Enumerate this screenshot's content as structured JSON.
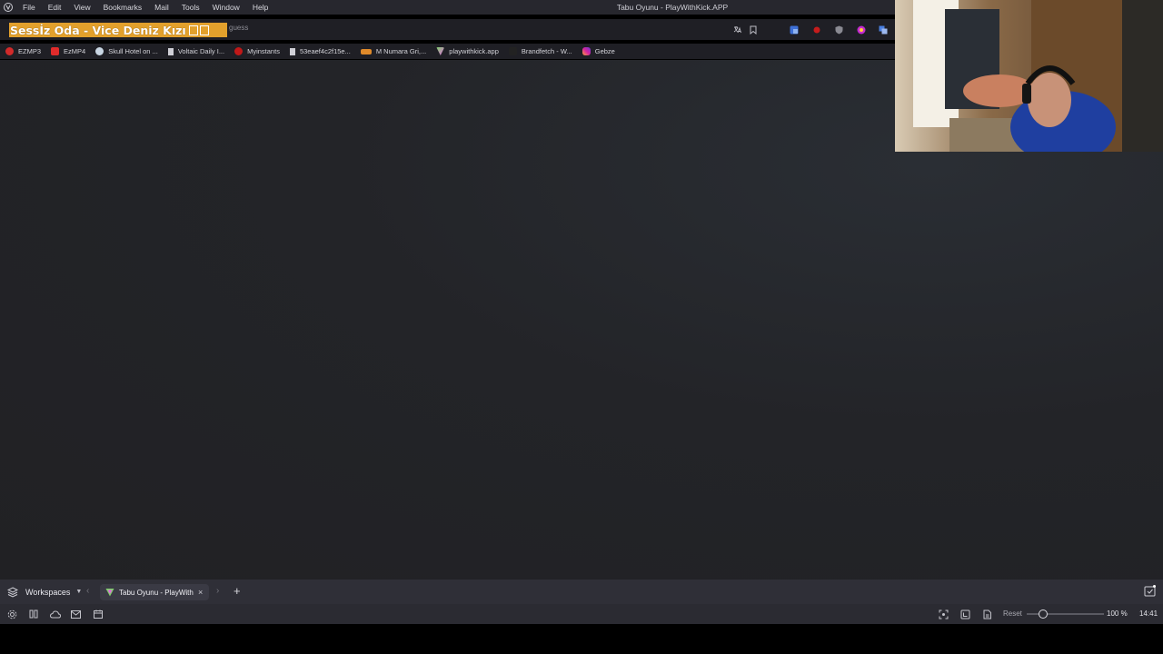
{
  "menubar": {
    "items": [
      "File",
      "Edit",
      "View",
      "Bookmarks",
      "Mail",
      "Tools",
      "Window",
      "Help"
    ],
    "window_title": "Tabu Oyunu - PlayWithKick.APP"
  },
  "overlay": {
    "title": "Sessİz Oda - Vice Deniz Kızı"
  },
  "addressbar": {
    "url_text": "guess"
  },
  "bookmarks": [
    {
      "label": "EZMP3",
      "icon": "ezmp3-icon",
      "color": "#d22a2a"
    },
    {
      "label": "EzMP4",
      "icon": "ezmp4-icon",
      "color": "#e02b2b"
    },
    {
      "label": "Skull Hotel on ...",
      "icon": "steam-icon",
      "color": "#1b2838"
    },
    {
      "label": "Voltaic Daily I...",
      "icon": "page-icon",
      "color": "#cfcfd6"
    },
    {
      "label": "Myinstants",
      "icon": "myinstants-icon",
      "color": "#c01818"
    },
    {
      "label": "53eaef4c2f15e...",
      "icon": "page-icon",
      "color": "#cfcfd6"
    },
    {
      "label": "M Numara Gri,...",
      "icon": "flo-icon",
      "color": "#e08a2a"
    },
    {
      "label": "playwithkick.app",
      "icon": "kick-icon",
      "color": "#7fd36b"
    },
    {
      "label": "Brandfetch - W...",
      "icon": "brandfetch-icon",
      "color": "#222222"
    },
    {
      "label": "Gebze",
      "icon": "instagram-icon",
      "color": "#d6249f"
    }
  ],
  "tabbar": {
    "workspaces_label": "Workspaces",
    "active_tab_title": "Tabu Oyunu - PlayWithKick.APP",
    "new_tab": "+",
    "close": "×"
  },
  "statusbar": {
    "reset_label": "Reset",
    "zoom": "100 %",
    "clock": "14:41"
  }
}
